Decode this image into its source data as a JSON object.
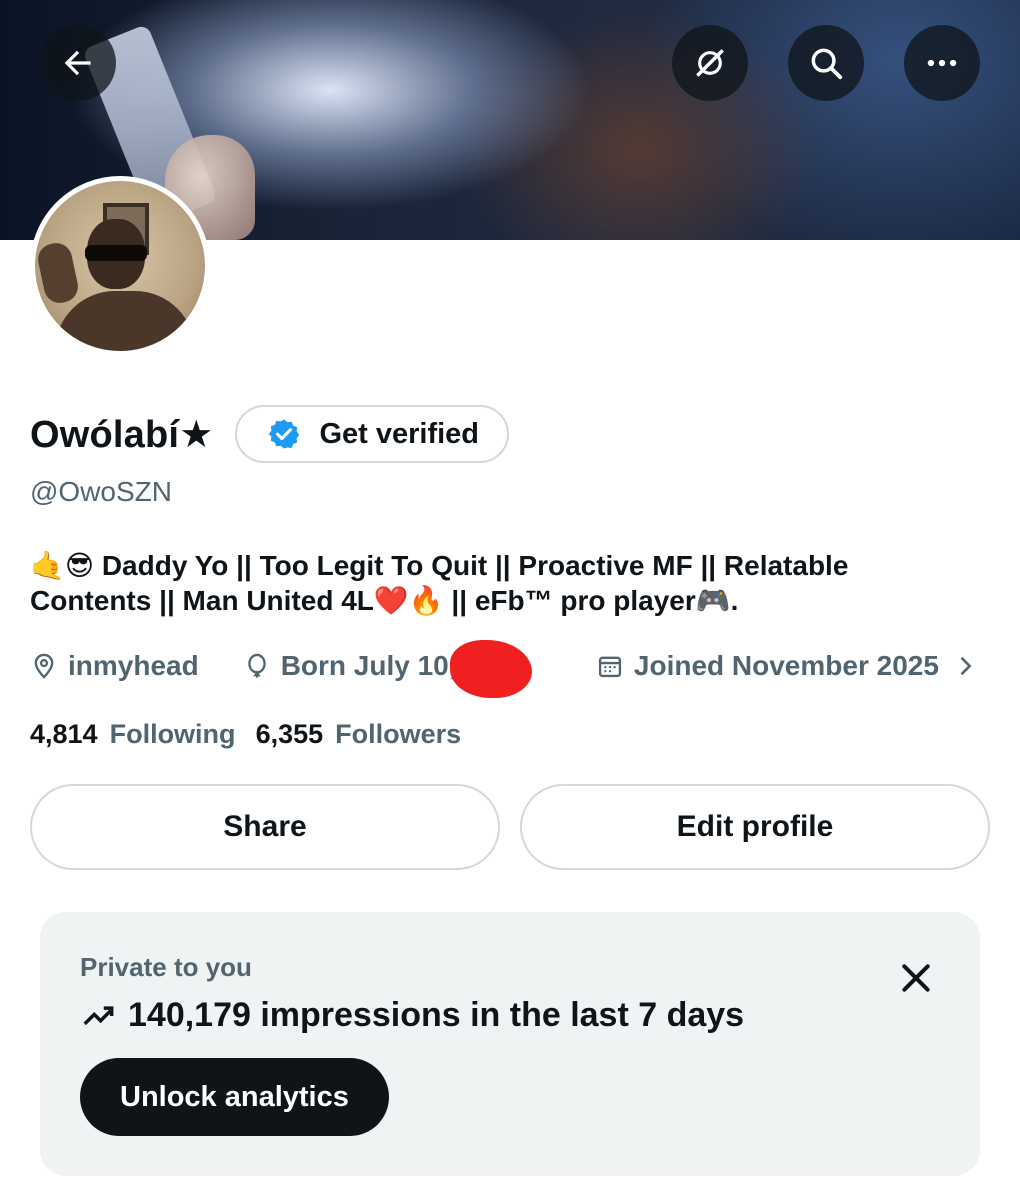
{
  "header": {
    "back_icon": "arrow-left-icon",
    "grok_icon": "grok-icon",
    "search_icon": "search-icon",
    "more_icon": "more-horizontal-icon"
  },
  "profile": {
    "display_name": "Owólabí★",
    "get_verified_label": "Get verified",
    "handle": "@OwoSZN",
    "bio_line1": "🤙😎 Daddy Yo || Too Legit To Quit || Proactive MF || Relatable",
    "bio_line2": "Contents || Man United 4L❤️🔥 || eFb™ pro player🎮.",
    "location": "inmyhead",
    "born": "Born July 10, 2",
    "joined": "Joined November 2025",
    "following_count": "4,814",
    "following_label": "Following",
    "followers_count": "6,355",
    "followers_label": "Followers"
  },
  "actions": {
    "share_label": "Share",
    "edit_label": "Edit profile"
  },
  "analytics_card": {
    "private_label": "Private to you",
    "impressions_text": "140,179 impressions in the last 7 days",
    "unlock_label": "Unlock analytics"
  },
  "colors": {
    "text_primary": "#0f1419",
    "text_secondary": "#536471",
    "verified_blue": "#1d9bf0",
    "card_bg": "#eff3f4"
  }
}
